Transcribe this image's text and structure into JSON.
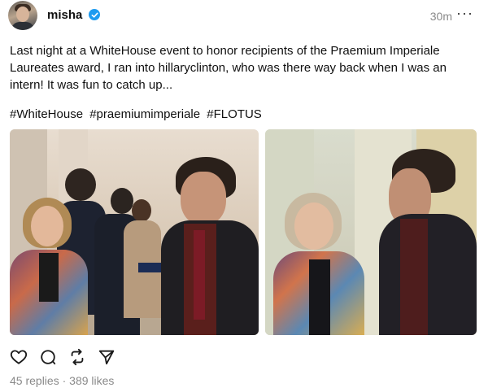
{
  "post": {
    "username": "misha",
    "verified": true,
    "timestamp": "30m",
    "more_label": "···",
    "text": "Last night at a WhiteHouse event to honor recipients of the Praemium Imperiale Laureates award, I ran into hillaryclinton, who was there way back when I was an intern! It was fun to catch up...",
    "hashtags": [
      "#WhiteHouse",
      "#praemiumimperiale",
      "#FLOTUS"
    ],
    "images": [
      "photo-1",
      "photo-2"
    ],
    "actions": [
      "heart-icon",
      "comment-icon",
      "repost-icon",
      "share-icon"
    ],
    "stats": {
      "replies": "45 replies",
      "separator": "·",
      "likes": "389 likes"
    }
  },
  "colors": {
    "text": "#101010",
    "muted": "#8a8a8a",
    "verified": "#1d9bf0"
  }
}
